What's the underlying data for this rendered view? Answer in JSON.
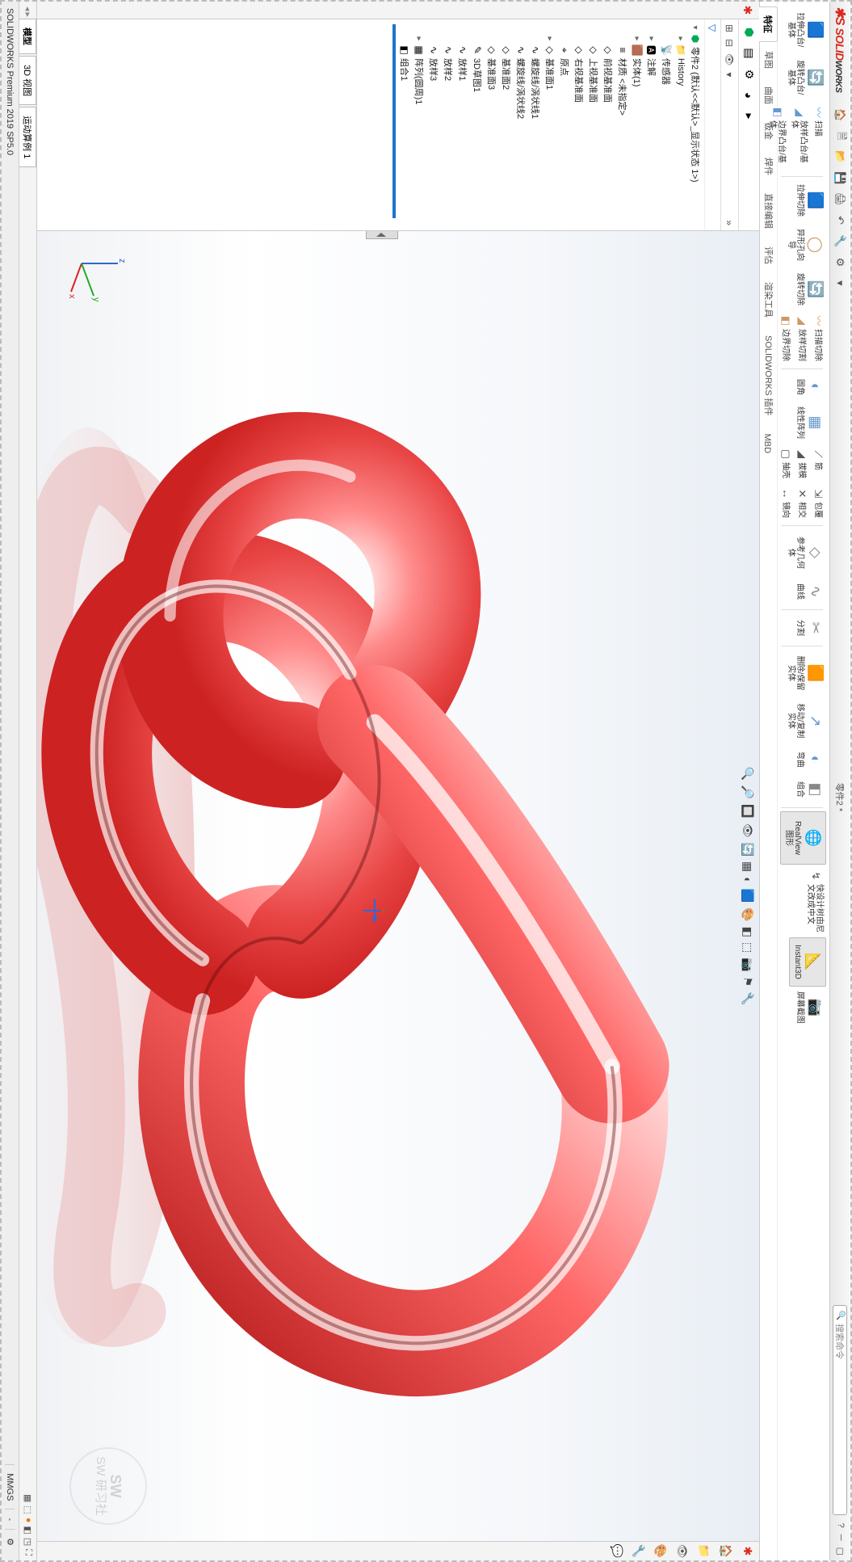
{
  "app_name": "SOLIDWORKS",
  "title": "零件2 *",
  "search_placeholder": "搜索命令",
  "ribbon": {
    "groups": [
      [
        {
          "ico": "🟦",
          "lbl": "拉伸凸台/基体",
          "c": "#8a6"
        },
        {
          "ico": "🔄",
          "lbl": "旋转凸台/基体",
          "c": "#8a6"
        }
      ],
      [
        {
          "ico": "〰",
          "lbl": "扫描",
          "small": true,
          "c": "#69c"
        },
        {
          "ico": "◢",
          "lbl": "放样凸台/基体",
          "small": true,
          "c": "#69c"
        },
        {
          "ico": "◧",
          "lbl": "边界凸台/基体",
          "small": true,
          "c": "#69c"
        }
      ],
      "sep",
      [
        {
          "ico": "🟦",
          "lbl": "拉伸切除",
          "c": "#c96"
        },
        {
          "ico": "◯",
          "lbl": "异形孔向导",
          "c": "#c96"
        },
        {
          "ico": "🔄",
          "lbl": "旋转切除",
          "c": "#c96"
        }
      ],
      [
        {
          "ico": "〰",
          "lbl": "扫描切除",
          "small": true,
          "c": "#c96"
        },
        {
          "ico": "◢",
          "lbl": "放样切割",
          "small": true,
          "c": "#c96"
        },
        {
          "ico": "◧",
          "lbl": "边界切除",
          "small": true,
          "c": "#c96"
        }
      ],
      "sep",
      [
        {
          "ico": "◐",
          "lbl": "圆角",
          "c": "#69c"
        },
        {
          "ico": "▦",
          "lbl": "线性阵列",
          "c": "#69c"
        }
      ],
      [
        {
          "ico": "⟋",
          "lbl": "筋",
          "small": true
        },
        {
          "ico": "◢",
          "lbl": "拔模",
          "small": true
        },
        {
          "ico": "▢",
          "lbl": "抽壳",
          "small": true
        }
      ],
      [
        {
          "ico": "⇲",
          "lbl": "包覆",
          "small": true
        },
        {
          "ico": "✕",
          "lbl": "相交",
          "small": true
        },
        {
          "ico": "↔",
          "lbl": "镜向",
          "small": true
        }
      ],
      "sep",
      [
        {
          "ico": "◇",
          "lbl": "参考几何体",
          "c": "#888"
        },
        {
          "ico": "∿",
          "lbl": "曲线",
          "c": "#888"
        }
      ],
      "sep",
      [
        {
          "ico": "✂",
          "lbl": "分割",
          "c": "#888"
        }
      ],
      "sep",
      [
        {
          "ico": "🟧",
          "lbl": "删除/保留实体",
          "c": "#c96"
        },
        {
          "ico": "↗",
          "lbl": "移动/复制实体",
          "c": "#69c"
        },
        {
          "ico": "◐",
          "lbl": "弯曲",
          "c": "#69c"
        },
        {
          "ico": "◧",
          "lbl": "组合",
          "c": "#888"
        }
      ],
      "sep",
      [
        {
          "ico": "🌐",
          "lbl": "RealView 图形",
          "big": true,
          "c": "#37a"
        }
      ],
      [
        {
          "ico": "↯",
          "lbl": "快设计树由尼文改成中文",
          "small": true
        }
      ],
      [
        {
          "ico": "📐",
          "lbl": "Instant3D",
          "big": true,
          "c": "#c96"
        }
      ],
      [
        {
          "ico": "📷",
          "lbl": "屏幕截图",
          "c": "#e55"
        }
      ]
    ]
  },
  "tabs": [
    "特征",
    "草图",
    "曲面",
    "钣金",
    "焊件",
    "直接编辑",
    "评估",
    "渲染工具",
    "SOLIDWORKS 插件",
    "MBD"
  ],
  "active_tab": 0,
  "view_tools": [
    "🔍",
    "🔎",
    "🔲",
    "👁",
    "🔄",
    "▦",
    "◐",
    "🟦",
    "🎨",
    "◧",
    "⬚",
    "📷",
    "⚑",
    "🔧"
  ],
  "tree": {
    "root": "零件2 (默认<<默认>_显示状态 1>)",
    "items": [
      {
        "ico": "📁",
        "txt": "History",
        "tw": "▸"
      },
      {
        "ico": "📡",
        "txt": "传感器"
      },
      {
        "ico": "🅰",
        "txt": "注解",
        "tw": "▸"
      },
      {
        "ico": "🟫",
        "txt": "实体(1)",
        "tw": "▸"
      },
      {
        "ico": "≡",
        "txt": "材质 <未指定>"
      },
      {
        "ico": "◇",
        "txt": "前视基准面"
      },
      {
        "ico": "◇",
        "txt": "上视基准面"
      },
      {
        "ico": "◇",
        "txt": "右视基准面"
      },
      {
        "ico": "⌖",
        "txt": "原点"
      },
      {
        "ico": "◇",
        "txt": "基准面1",
        "tw": "▸"
      },
      {
        "ico": "∿",
        "txt": "螺旋线/涡状线1"
      },
      {
        "ico": "∿",
        "txt": "螺旋线/涡状线2"
      },
      {
        "ico": "◇",
        "txt": "基准面2"
      },
      {
        "ico": "◇",
        "txt": "基准面3"
      },
      {
        "ico": "✎",
        "txt": "3D草图1"
      },
      {
        "ico": "∿",
        "txt": "放样1"
      },
      {
        "ico": "∿",
        "txt": "放样2"
      },
      {
        "ico": "∿",
        "txt": "放样3"
      },
      {
        "ico": "▦",
        "txt": "阵列(圆周)1",
        "tw": "▸"
      },
      {
        "ico": "◧",
        "txt": "组合1"
      }
    ]
  },
  "bottom_tabs": [
    "模型",
    "3D 视图",
    "运动算例 1"
  ],
  "active_bottom_tab": 0,
  "status": {
    "left": "SOLIDWORKS Premium 2019 SP5.0",
    "units": "MMGS",
    "extra": "-"
  },
  "watermark": "SW\n研习社"
}
